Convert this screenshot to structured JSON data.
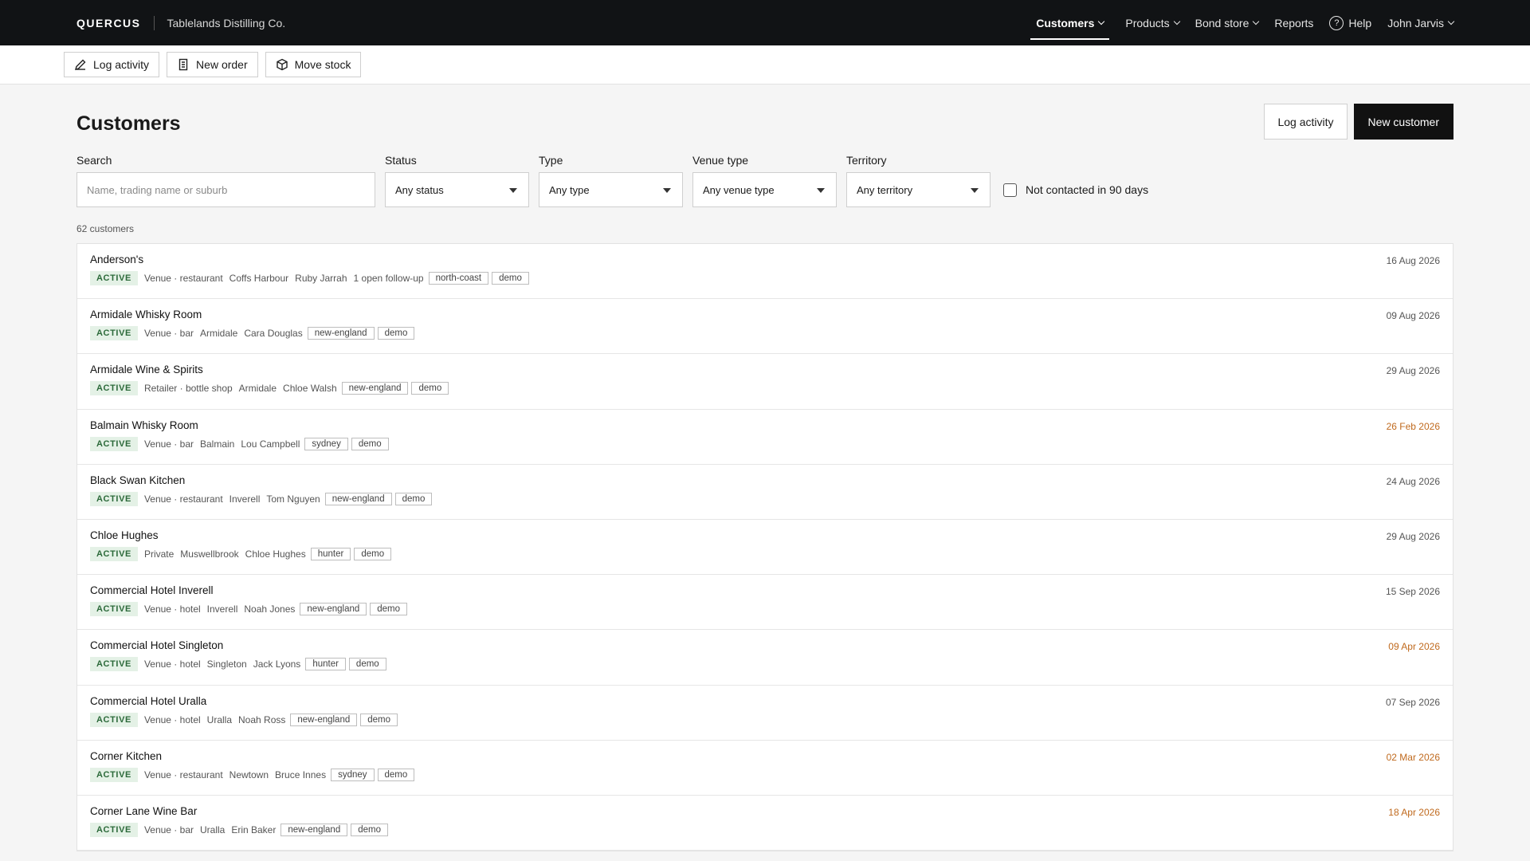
{
  "nav": {
    "brand": "QUERCUS",
    "company": "Tablelands Distilling Co.",
    "items": [
      {
        "label": "Customers"
      },
      {
        "label": "Products"
      },
      {
        "label": "Bond store"
      },
      {
        "label": "Reports"
      },
      {
        "label": "Help"
      },
      {
        "label": "John Jarvis"
      }
    ]
  },
  "actions": {
    "log_activity": "Log activity",
    "new_order": "New order",
    "move_stock": "Move stock"
  },
  "page": {
    "title": "Customers",
    "log_activity_button": "Log activity",
    "new_customer_button": "New customer"
  },
  "filters": {
    "search_label": "Search",
    "search_placeholder": "Name, trading name or suburb",
    "status_label": "Status",
    "status_value": "Any status",
    "type_label": "Type",
    "type_value": "Any type",
    "venue_label": "Venue type",
    "venue_value": "Any venue type",
    "territory_label": "Territory",
    "territory_value": "Any territory",
    "not_contacted_label": "Not contacted in 90 days"
  },
  "count": "62 customers",
  "customers": [
    {
      "name": "Anderson's",
      "status": "ACTIVE",
      "type": "Venue · restaurant",
      "suburb": "Coffs Harbour",
      "contact": "Ruby Jarrah",
      "extra": "1 open follow-up",
      "tags": [
        "north-coast",
        "demo"
      ],
      "date": "16 Aug 2026",
      "overdue": false
    },
    {
      "name": "Armidale Whisky Room",
      "status": "ACTIVE",
      "type": "Venue · bar",
      "suburb": "Armidale",
      "contact": "Cara Douglas",
      "extra": "",
      "tags": [
        "new-england",
        "demo"
      ],
      "date": "09 Aug 2026",
      "overdue": false
    },
    {
      "name": "Armidale Wine & Spirits",
      "status": "ACTIVE",
      "type": "Retailer · bottle shop",
      "suburb": "Armidale",
      "contact": "Chloe Walsh",
      "extra": "",
      "tags": [
        "new-england",
        "demo"
      ],
      "date": "29 Aug 2026",
      "overdue": false
    },
    {
      "name": "Balmain Whisky Room",
      "status": "ACTIVE",
      "type": "Venue · bar",
      "suburb": "Balmain",
      "contact": "Lou Campbell",
      "extra": "",
      "tags": [
        "sydney",
        "demo"
      ],
      "date": "26 Feb 2026",
      "overdue": true
    },
    {
      "name": "Black Swan Kitchen",
      "status": "ACTIVE",
      "type": "Venue · restaurant",
      "suburb": "Inverell",
      "contact": "Tom Nguyen",
      "extra": "",
      "tags": [
        "new-england",
        "demo"
      ],
      "date": "24 Aug 2026",
      "overdue": false
    },
    {
      "name": "Chloe Hughes",
      "status": "ACTIVE",
      "type": "Private",
      "suburb": "Muswellbrook",
      "contact": "Chloe Hughes",
      "extra": "",
      "tags": [
        "hunter",
        "demo"
      ],
      "date": "29 Aug 2026",
      "overdue": false
    },
    {
      "name": "Commercial Hotel Inverell",
      "status": "ACTIVE",
      "type": "Venue · hotel",
      "suburb": "Inverell",
      "contact": "Noah Jones",
      "extra": "",
      "tags": [
        "new-england",
        "demo"
      ],
      "date": "15 Sep 2026",
      "overdue": false
    },
    {
      "name": "Commercial Hotel Singleton",
      "status": "ACTIVE",
      "type": "Venue · hotel",
      "suburb": "Singleton",
      "contact": "Jack Lyons",
      "extra": "",
      "tags": [
        "hunter",
        "demo"
      ],
      "date": "09 Apr 2026",
      "overdue": true
    },
    {
      "name": "Commercial Hotel Uralla",
      "status": "ACTIVE",
      "type": "Venue · hotel",
      "suburb": "Uralla",
      "contact": "Noah Ross",
      "extra": "",
      "tags": [
        "new-england",
        "demo"
      ],
      "date": "07 Sep 2026",
      "overdue": false
    },
    {
      "name": "Corner Kitchen",
      "status": "ACTIVE",
      "type": "Venue · restaurant",
      "suburb": "Newtown",
      "contact": "Bruce Innes",
      "extra": "",
      "tags": [
        "sydney",
        "demo"
      ],
      "date": "02 Mar 2026",
      "overdue": true
    },
    {
      "name": "Corner Lane Wine Bar",
      "status": "ACTIVE",
      "type": "Venue · bar",
      "suburb": "Uralla",
      "contact": "Erin Baker",
      "extra": "",
      "tags": [
        "new-england",
        "demo"
      ],
      "date": "18 Apr 2026",
      "overdue": true
    }
  ]
}
